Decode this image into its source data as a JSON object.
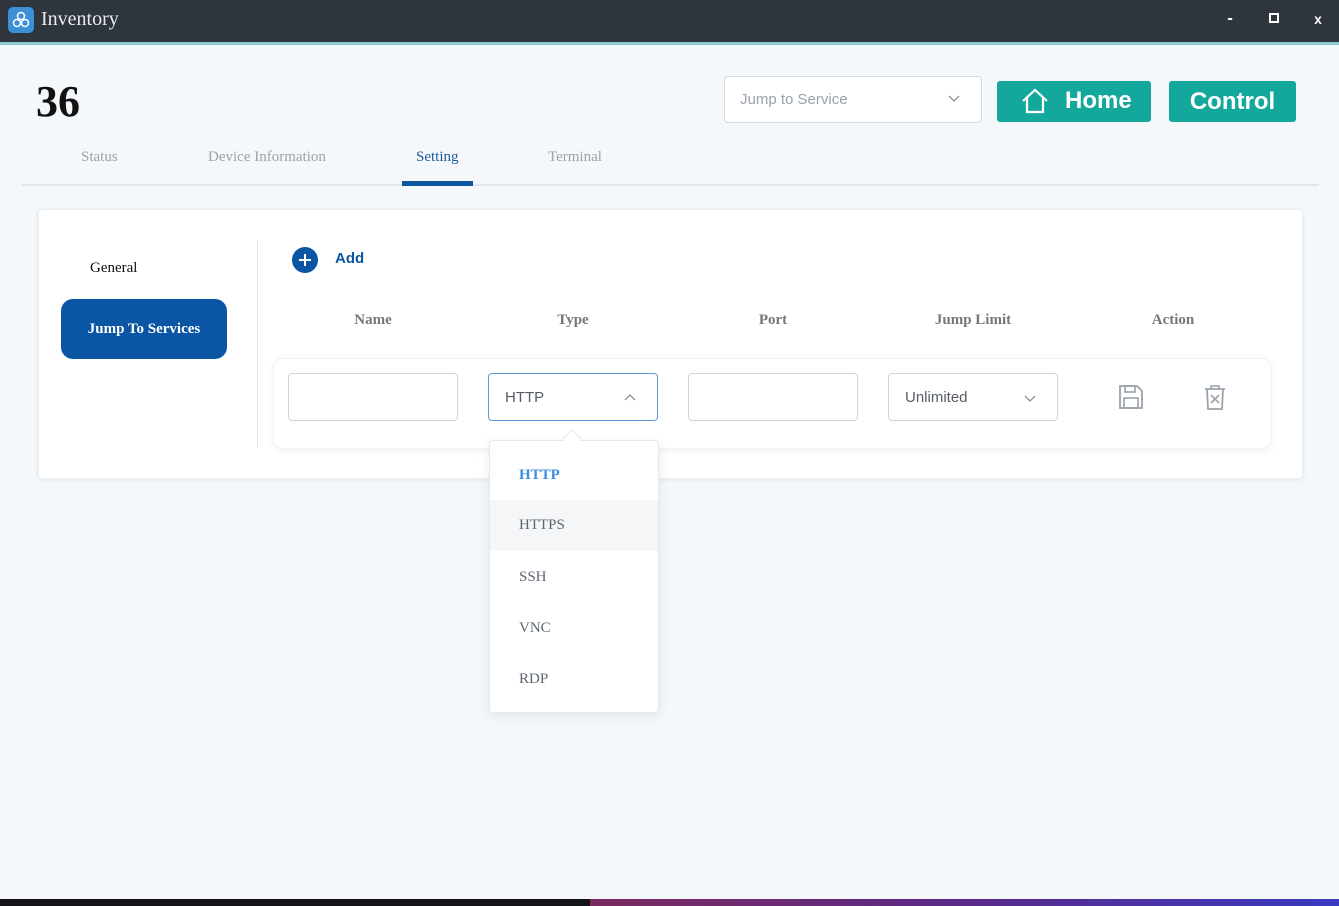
{
  "window": {
    "title": "Inventory",
    "min_label": "-",
    "close_label": "x"
  },
  "header": {
    "page_number": "36",
    "jump_select": {
      "placeholder": "Jump to Service"
    },
    "home_label": "Home",
    "control_label": "Control"
  },
  "tabs": [
    {
      "label": "Status"
    },
    {
      "label": "Device Information"
    },
    {
      "label": "Setting",
      "active": true
    },
    {
      "label": "Terminal"
    }
  ],
  "sidebar": {
    "items": [
      {
        "label": "General"
      },
      {
        "label": "Jump To Services",
        "active": true
      }
    ]
  },
  "services": {
    "add_label": "Add",
    "columns": [
      "Name",
      "Type",
      "Port",
      "Jump Limit",
      "Action"
    ],
    "row": {
      "name": "",
      "type": "HTTP",
      "port": "",
      "jump_limit": "Unlimited"
    }
  },
  "type_dropdown": {
    "options": [
      "HTTP",
      "HTTPS",
      "SSH",
      "VNC",
      "RDP"
    ],
    "selected": "HTTP",
    "hovered": "HTTPS"
  },
  "colors": {
    "primary": "#0b56a4",
    "teal": "#14a89c",
    "titlebar": "#2e353d"
  }
}
